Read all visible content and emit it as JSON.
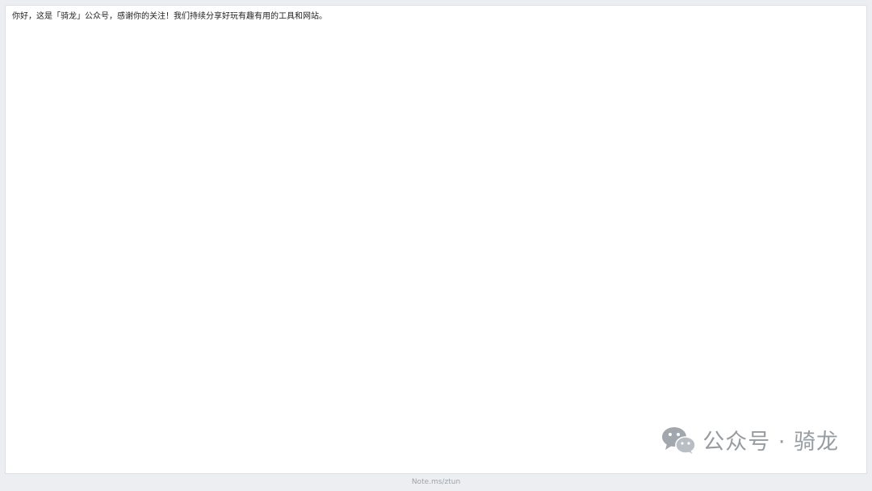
{
  "note": {
    "content": "你好，这是「骑龙」公众号，感谢你的关注！我们持续分享好玩有趣有用的工具和网站。"
  },
  "watermark": {
    "text": "公众号 · 骑龙",
    "icon": "wechat-icon"
  },
  "footer": {
    "link_text": "Note.ms/ztun"
  }
}
